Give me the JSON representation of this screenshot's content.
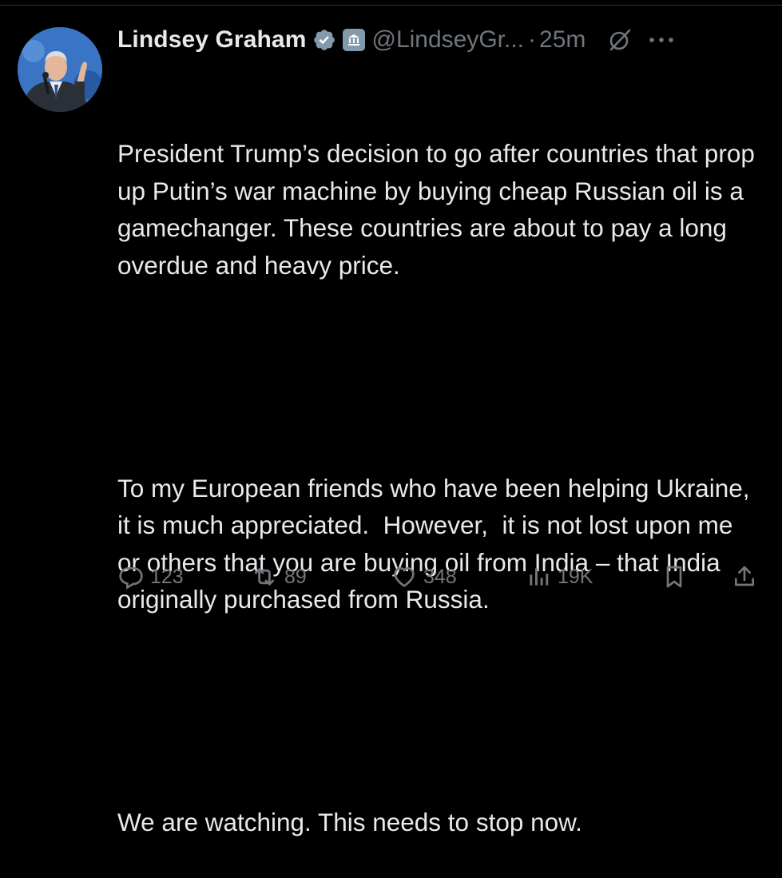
{
  "author": {
    "display_name": "Lindsey Graham",
    "handle": "@LindseyGr...",
    "separator": "·",
    "timestamp": "25m",
    "verified_icon": "verified-badge-icon",
    "affiliation_icon": "government-building-icon",
    "avatar": "profile-photo"
  },
  "tweet": {
    "paragraphs": [
      "President Trump’s decision to go after countries that prop up Putin’s war machine by buying cheap Russian oil is a gamechanger. These countries are about to pay a long overdue and heavy price.",
      "To my European friends who have been helping Ukraine, it is much appreciated.  However,  it is not lost upon me or others that you are buying oil from India – that India originally purchased from Russia.",
      "We are watching. This needs to stop now."
    ]
  },
  "actions": {
    "replies": "123",
    "reposts": "89",
    "likes": "348",
    "views": "19K"
  },
  "colors": {
    "background": "#000000",
    "text": "#e7e9ea",
    "muted": "#71767b",
    "verified": "#829aab"
  }
}
